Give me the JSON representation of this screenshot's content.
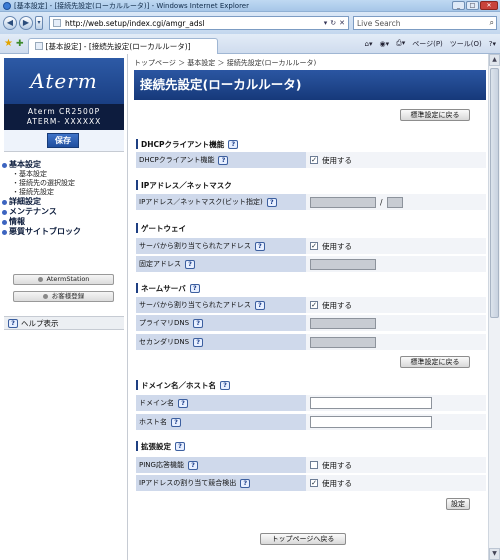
{
  "browser": {
    "window_title": "[基本設定] - [接続先設定(ローカルルータ)] - Windows Internet Explorer",
    "url": "http://web.setup/index.cgi/amgr_adsl",
    "search_placeholder": "Live Search",
    "tab_title": "[基本設定] - [接続先設定(ローカルルータ)]",
    "page_menu": "ページ(P)",
    "tools_menu": "ツール(O)"
  },
  "sidebar": {
    "logo": "Aterm",
    "model_line1": "Aterm CR2500P",
    "model_line2": "ATERM- XXXXXX",
    "save_label": "保存",
    "menu": [
      {
        "label": "基本設定",
        "subs": [
          "基本設定",
          "接続先の選択設定",
          "接続先設定"
        ]
      },
      {
        "label": "詳細設定",
        "subs": []
      },
      {
        "label": "メンテナンス",
        "subs": []
      },
      {
        "label": "情報",
        "subs": []
      },
      {
        "label": "悪質サイトブロック",
        "subs": []
      }
    ],
    "aterm_station": "AtermStation",
    "registration": "お客様登録",
    "help": "ヘルプ表示"
  },
  "main": {
    "breadcrumb": "トップページ ＞ 基本設定 ＞ 接続先設定(ローカルルータ)",
    "title": "接続先設定(ローカルルータ)",
    "default_button": "標準設定に戻る",
    "dhcp": {
      "heading": "DHCPクライアント機能",
      "row_label": "DHCPクライアント機能",
      "use": "使用する"
    },
    "ip": {
      "heading": "IPアドレス／ネットマスク",
      "row_label": "IPアドレス／ネットマスク(ビット指定)",
      "slash": "/"
    },
    "gateway": {
      "heading": "ゲートウェイ",
      "row1": "サーバから割り当てられたアドレス",
      "row2": "固定アドレス",
      "use": "使用する"
    },
    "nameserver": {
      "heading": "ネームサーバ",
      "row1": "サーバから割り当てられたアドレス",
      "row2": "プライマリDNS",
      "row3": "セカンダリDNS",
      "use": "使用する",
      "default_button": "標準設定に戻る"
    },
    "domain": {
      "heading": "ドメイン名／ホスト名",
      "row1": "ドメイン名",
      "row2": "ホスト名"
    },
    "extended": {
      "heading": "拡張設定",
      "row1": "PING応答機能",
      "row2": "IPアドレスの割り当て競合検出",
      "use": "使用する"
    },
    "set_button": "設定",
    "top_button": "トップページへ戻る"
  }
}
